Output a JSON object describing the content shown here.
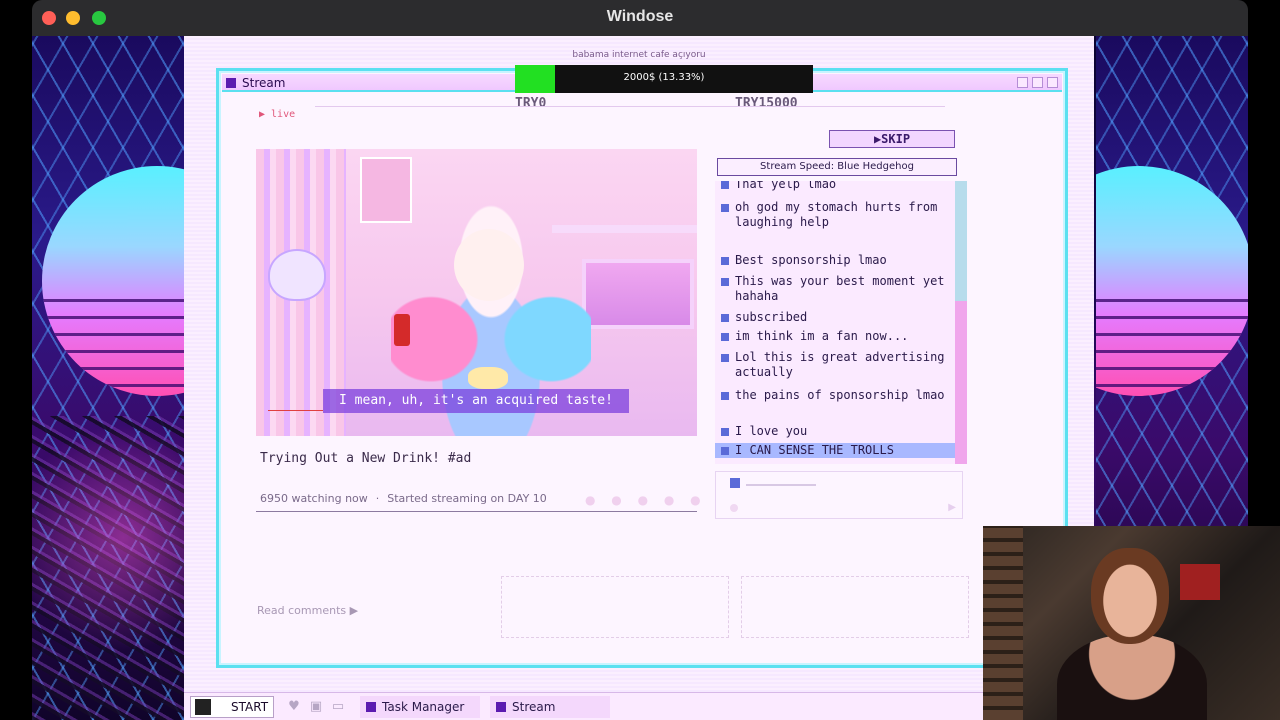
{
  "mac_window": {
    "title": "Windose"
  },
  "desktop": {
    "header": "babama internet cafe açıyoru"
  },
  "stream_window": {
    "title": "Stream",
    "progress": {
      "text": "2000$ (13.33%)",
      "fraction": 0.1333,
      "fill_color": "#22e022"
    },
    "try_min": "TRY0",
    "try_max": "TRY15000",
    "live_label": "▶ live",
    "subtitle": "I mean, uh, it's an acquired taste!",
    "video_title": "Trying Out a New Drink! #ad",
    "watching": "6950 watching now",
    "meta_separator": "·",
    "started": "Started streaming on DAY 10",
    "skip_label": "▶SKIP",
    "speed_label": "Stream Speed: Blue Hedgehog",
    "chat": [
      {
        "text": "That yelp lmao"
      },
      {
        "text": "oh god my stomach hurts from laughing help"
      },
      {
        "text": "Best sponsorship lmao"
      },
      {
        "text": "This was your best moment yet hahaha"
      },
      {
        "text": "subscribed"
      },
      {
        "text": "im think im a fan now..."
      },
      {
        "text": "Lol this is great advertising actually"
      },
      {
        "text": "the pains of sponsorship lmao"
      },
      {
        "text": "I love you"
      },
      {
        "text": "I CAN SENSE THE TROLLS"
      }
    ],
    "read_comments": "Read comments ▶"
  },
  "taskbar": {
    "start_label": "START",
    "tray_icons": [
      "twitter-icon",
      "chat-icon",
      "monitor-icon"
    ],
    "tasks": [
      {
        "label": "Task Manager"
      },
      {
        "label": "Stream"
      }
    ]
  },
  "colors": {
    "accent": "#5be0f0",
    "chat_highlight": "#a8b8ff",
    "bullet": "#5a6ad8"
  }
}
